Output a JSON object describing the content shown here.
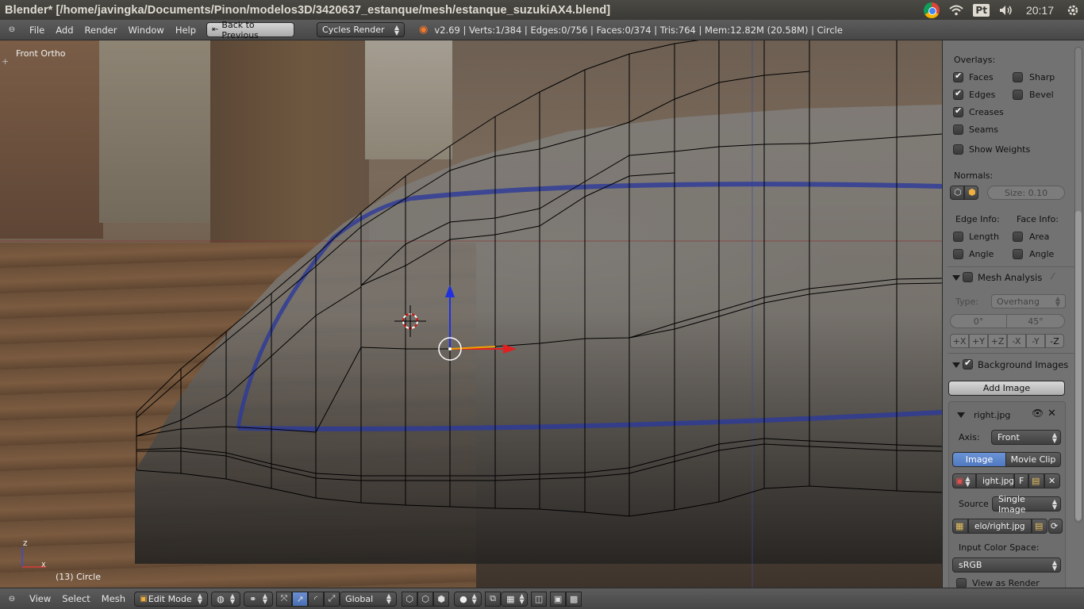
{
  "os": {
    "title": "Blender* [/home/javingka/Documents/Pinon/modelos3D/3420637_estanque/mesh/estanque_suzukiAX4.blend]",
    "keyboard": "Pt",
    "clock": "20:17"
  },
  "info_header": {
    "menus": [
      "File",
      "Add",
      "Render",
      "Window",
      "Help"
    ],
    "back_button": "Back to Previous",
    "render_engine": "Cycles Render",
    "stats": "v2.69 | Verts:1/384 | Edges:0/756 | Faces:0/374 | Tris:764 | Mem:12.82M (20.58M) | Circle"
  },
  "viewport": {
    "view_label": "Front Ortho",
    "object_label": "(13) Circle",
    "axis_x": "X",
    "axis_z": "Z"
  },
  "bottom_header": {
    "menus": [
      "View",
      "Select",
      "Mesh"
    ],
    "mode": "Edit Mode",
    "orientation": "Global"
  },
  "properties": {
    "overlays_label": "Overlays:",
    "overlays": [
      {
        "label": "Faces",
        "checked": true
      },
      {
        "label": "Sharp",
        "checked": false
      },
      {
        "label": "Edges",
        "checked": true
      },
      {
        "label": "Bevel",
        "checked": false
      },
      {
        "label": "Creases",
        "checked": true
      },
      {
        "label": "Seams",
        "checked": false
      },
      {
        "label": "Show Weights",
        "checked": false
      }
    ],
    "normals_label": "Normals:",
    "normals_size": "Size: 0.10",
    "edge_info_label": "Edge Info:",
    "face_info_label": "Face Info:",
    "edge_info": [
      "Length",
      "Angle"
    ],
    "face_info": [
      "Area",
      "Angle"
    ],
    "mesh_analysis": {
      "title": "Mesh Analysis",
      "type_label": "Type:",
      "type_value": "Overhang",
      "min": "0°",
      "max": "45°",
      "axes": [
        "+X",
        "+Y",
        "+Z",
        "-X",
        "-Y",
        "-Z"
      ],
      "active_axis": "-Z"
    },
    "background_images": {
      "title": "Background Images",
      "add_button": "Add Image",
      "image_name": "right.jpg",
      "axis_label": "Axis:",
      "axis_value": "Front",
      "tab_image": "Image",
      "tab_movie": "Movie Clip",
      "file_field": "ight.jpg",
      "file_flag": "F",
      "source_label": "Source",
      "source_value": "Single Image",
      "path_field": "elo/right.jpg",
      "color_space_label": "Input Color Space:",
      "color_space_value": "sRGB",
      "view_as_render": "View as Render"
    }
  },
  "colors": {
    "accent_blue": "#5680c2",
    "panel_bg": "#727272",
    "header_bg": "#4b4b4b",
    "wire": "#000000"
  }
}
